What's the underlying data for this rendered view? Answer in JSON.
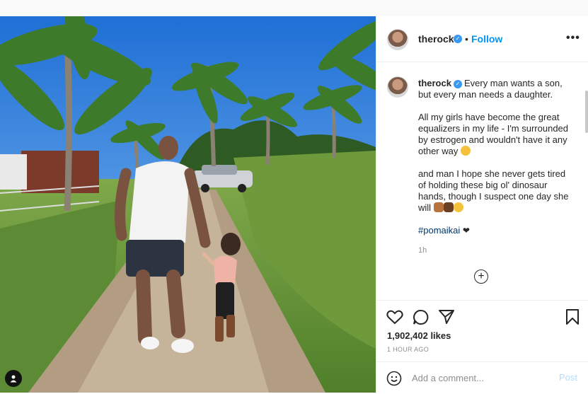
{
  "post": {
    "username": "therock",
    "follow_label": "Follow",
    "more_label": "•••",
    "caption_paragraphs": [
      "Every man wants a son, but every man needs a daughter.",
      "All my girls have become the great equalizers in my life - I'm surrounded by estrogen and wouldn't have it any other way",
      "and man I hope she never gets tired of holding these big ol' dinosaur hands, though I suspect one day she will"
    ],
    "hashtag": "#pomaikai",
    "time_ago": "1h",
    "likes": "1,902,402 likes",
    "posted_time": "1 HOUR AGO",
    "comment_placeholder": "Add a comment...",
    "post_label": "Post"
  },
  "colors": {
    "link_blue": "#0095f6",
    "verified_blue": "#3897f0",
    "hashtag": "#00376b",
    "muted": "#8e8e8e"
  }
}
